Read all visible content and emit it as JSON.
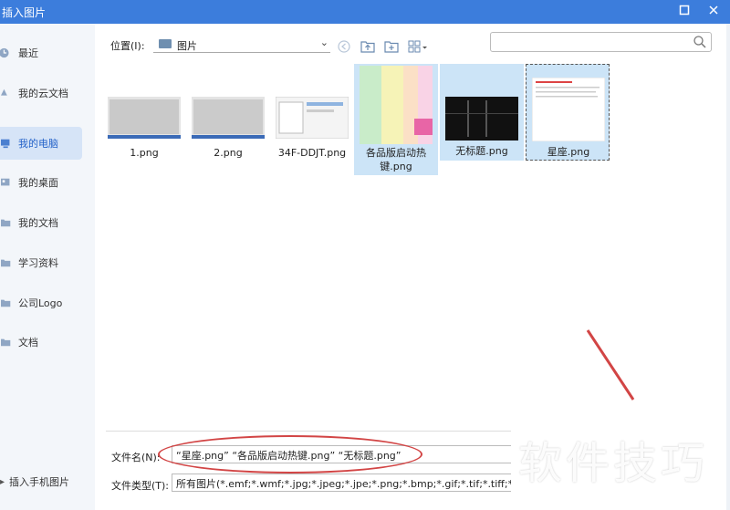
{
  "window": {
    "title": "插入图片",
    "maximize_icon": "maximize-icon",
    "close_icon": "close-icon"
  },
  "sidebar": {
    "items": [
      {
        "label": "最近",
        "icon": "clock-icon"
      },
      {
        "label": "我的云文档",
        "icon": "cloud-icon"
      },
      {
        "label": "我的电脑",
        "icon": "computer-icon"
      },
      {
        "label": "我的桌面",
        "icon": "desktop-icon"
      },
      {
        "label": "我的文档",
        "icon": "folder-icon"
      },
      {
        "label": "学习资料",
        "icon": "folder-icon"
      },
      {
        "label": "公司Logo",
        "icon": "folder-icon"
      },
      {
        "label": "文档",
        "icon": "folder-icon"
      }
    ],
    "active_index": 2,
    "phone_link": "插入手机图片"
  },
  "location": {
    "label": "位置(I):",
    "value": "图片"
  },
  "search": {
    "placeholder": ""
  },
  "files": [
    {
      "name": "1.png",
      "selected": false
    },
    {
      "name": "2.png",
      "selected": false
    },
    {
      "name": "34F-DDJT.png",
      "selected": false
    },
    {
      "name": "各品版启动热键.png",
      "selected": true
    },
    {
      "name": "无标题.png",
      "selected": true
    },
    {
      "name": "星座.png",
      "selected": true
    }
  ],
  "filename": {
    "label": "文件名(N):",
    "value": "“星座.png” “各品版启动热键.png” “无标题.png”"
  },
  "filetype": {
    "label": "文件类型(T):",
    "value": "所有图片(*.emf;*.wmf;*.jpg;*.jpeg;*.jpe;*.png;*.bmp;*.gif;*.tif;*.tiff;*.wdp;*.svg)"
  },
  "watermark": "软件技巧",
  "colors": {
    "titlebar": "#3c7ddc",
    "selection": "#cce4f7",
    "accent": "#2563c9",
    "annotation": "#d24545"
  }
}
